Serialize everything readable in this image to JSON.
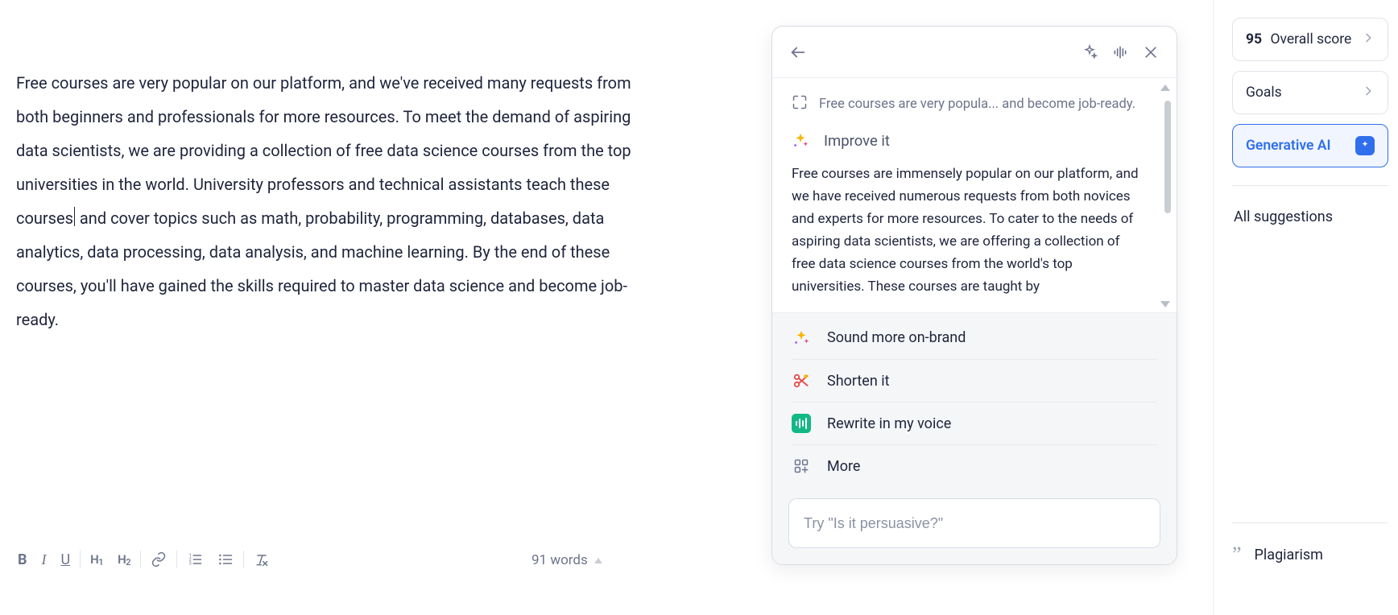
{
  "editor": {
    "text_before_cursor": "Free courses are very popular on our platform, and we've received many requests from both beginners and professionals for more resources. To meet the demand of aspiring data scientists, we are providing a collection of free data science courses from the top universities in the world. University professors and technical assistants teach these courses",
    "text_after_cursor": " and cover topics such as math, probability, programming, databases, data analytics, data processing, data analysis, and machine learning. By the end of these courses, you'll have gained the skills required to master data science and become job-ready."
  },
  "bottombar": {
    "word_count_label": "91 words"
  },
  "ai_panel": {
    "context_snippet": "Free courses are very popula... and become job-ready.",
    "improve_label": "Improve it",
    "output_text": "Free courses are immensely popular on our platform, and we have received numerous requests from both novices and experts for more resources. To cater to the needs of aspiring data scientists, we are offering a collection of free data science courses from the world's top universities. These courses are taught by",
    "options": {
      "on_brand": "Sound more on-brand",
      "shorten": "Shorten it",
      "rewrite_voice": "Rewrite in my voice",
      "more": "More"
    },
    "input_placeholder": "Try \"Is it persuasive?\""
  },
  "right_rail": {
    "score_value": "95",
    "score_label": "Overall score",
    "goals_label": "Goals",
    "gen_ai_label": "Generative AI",
    "all_suggestions_label": "All suggestions",
    "plagiarism_label": "Plagiarism"
  }
}
